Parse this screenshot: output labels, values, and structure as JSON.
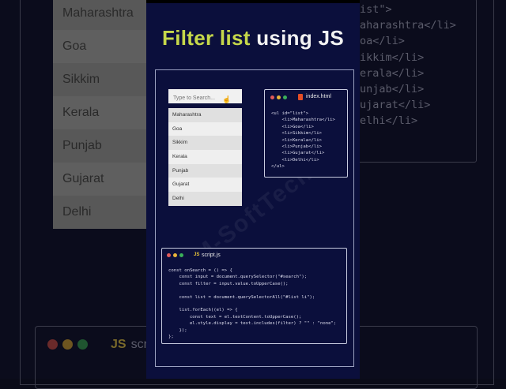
{
  "title": {
    "highlight": "Filter list",
    "rest": " using JS"
  },
  "search": {
    "placeholder": "Type to Search..."
  },
  "list": [
    "Maharashtra",
    "Goa",
    "Sikkim",
    "Kerala",
    "Punjab",
    "Gujarat",
    "Delhi"
  ],
  "html_window": {
    "filename": "index.html",
    "icon": "html5-icon",
    "code": [
      "<ul id=\"list\">",
      "    <li>Maharashtra</li>",
      "    <li>Goa</li>",
      "    <li>Sikkim</li>",
      "    <li>Kerala</li>",
      "    <li>Punjab</li>",
      "    <li>Gujarat</li>",
      "    <li>Delhi</li>",
      "</ul>"
    ]
  },
  "js_window": {
    "filename": "script.js",
    "icon_label": "JS",
    "code": [
      "const onSearch = () => {",
      "    const input = document.querySelector(\"#search\");",
      "    const filter = input.value.toUpperCase();",
      "",
      "    const list = document.querySelectorAll(\"#list li\");",
      "",
      "    list.forEach((el) => {",
      "        const text = el.textContent.toUpperCase();",
      "        el.style.display = text.includes(filter) ? \"\" : \"none\";",
      "    });",
      "};"
    ]
  },
  "background": {
    "code": [
      "ist\">",
      "aharashtra</li>",
      "oa</li>",
      "ikkim</li>",
      "erala</li>",
      "unjab</li>",
      "ujarat</li>",
      "elhi</li>"
    ],
    "js_label": "JS",
    "js_file": "scri"
  },
  "watermark": "M-SoftTech",
  "colors": {
    "accent": "#c6d84a",
    "panel": "#0b0f3c",
    "red": "#e05a5a",
    "yellow": "#e8b43a",
    "green": "#3ab05a"
  }
}
